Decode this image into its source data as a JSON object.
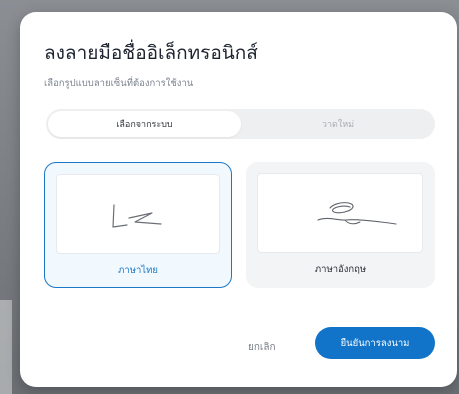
{
  "dialog": {
    "title": "ลงลายมือชื่ออิเล็กทรอนิกส์",
    "subtitle": "เลือกรูปแบบลายเซ็นที่ต้องการใช้งาน"
  },
  "tabs": [
    {
      "label": "เลือกจากระบบ",
      "active": true
    },
    {
      "label": "วาดใหม่",
      "active": false
    }
  ],
  "signature_options": [
    {
      "label": "ภาษาไทย",
      "selected": true,
      "icon": "thai-signature-image"
    },
    {
      "label": "ภาษาอังกฤษ",
      "selected": false,
      "icon": "english-signature-image"
    }
  ],
  "actions": {
    "cancel_label": "ยกเลิก",
    "confirm_label": "ยืนยันการลงนาม"
  },
  "colors": {
    "accent": "#1274c8",
    "selected_border": "#1b78c6",
    "selected_bg": "#f1f8fe",
    "card_bg": "#f3f4f6"
  }
}
